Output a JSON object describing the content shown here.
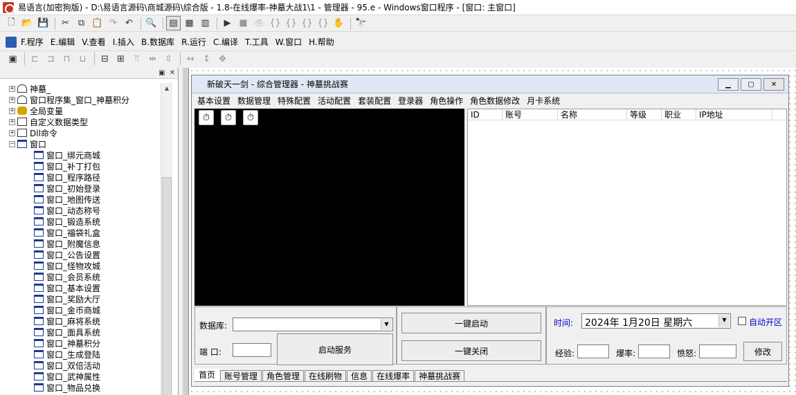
{
  "window": {
    "title": "易语言(加密狗版) - D:\\易语言源码\\商城源码\\综合版 - 1.8-在线爆率-神墓大战1\\1 - 管理器 - 95.e - Windows窗口程序 - [窗口: 主窗口]"
  },
  "toolbar1": {
    "icons": [
      "new-file-icon",
      "open-folder-icon",
      "save-icon",
      "cut-icon",
      "copy-icon",
      "paste-icon",
      "redo-icon",
      "undo-icon",
      "find-icon",
      "layout-1-icon",
      "layout-2-icon",
      "layout-3-icon",
      "run-icon",
      "stop-icon",
      "step-1-icon",
      "step-2-icon",
      "step-3-icon",
      "step-4-icon",
      "step-5-icon",
      "hand-icon",
      "binoculars-icon"
    ]
  },
  "menubar": {
    "items": [
      "F.程序",
      "E.编辑",
      "V.查看",
      "I.插入",
      "B.数据库",
      "R.运行",
      "C.编译",
      "T.工具",
      "W.窗口",
      "H.帮助"
    ]
  },
  "tree": {
    "roots": [
      {
        "label": "神墓_",
        "icon": "library-icon",
        "expander": "+"
      },
      {
        "label": "窗口程序集_窗口_神墓积分",
        "icon": "library-icon",
        "expander": "+"
      },
      {
        "label": "全局变量",
        "icon": "database-icon",
        "expander": "+"
      },
      {
        "label": "自定义数据类型",
        "icon": "type-icon",
        "expander": "+"
      },
      {
        "label": "Dll命令",
        "icon": "dll-icon",
        "expander": "+"
      },
      {
        "label": "窗口",
        "icon": "window-icon",
        "expander": "−"
      }
    ],
    "children": [
      "窗口_绑元商城",
      "窗口_补丁打包",
      "窗口_程序路径",
      "窗口_初始登录",
      "窗口_地图传送",
      "窗口_动态称号",
      "窗口_锻造系统",
      "窗口_福袋礼盒",
      "窗口_附魔信息",
      "窗口_公告设置",
      "窗口_怪物攻城",
      "窗口_会员系统",
      "窗口_基本设置",
      "窗口_奖励大厅",
      "窗口_金币商城",
      "窗口_麻将系统",
      "窗口_面具系统",
      "窗口_神墓积分",
      "窗口_生成登陆",
      "窗口_双倍活动",
      "窗口_武神属性",
      "窗口_物品兑换"
    ]
  },
  "form": {
    "title": "新破天一剑 - 综合管理器 - 神墓挑战赛",
    "menu": [
      "基本设置",
      "数据管理",
      "特殊配置",
      "活动配置",
      "套装配置",
      "登录器",
      "角色操作",
      "角色数据修改",
      "月卡系统"
    ],
    "grid_columns": [
      "ID",
      "账号",
      "名称",
      "等级",
      "职业",
      "IP地址"
    ],
    "db_label": "数据库:",
    "port_label": "端  口:",
    "start_service": "启动服务",
    "one_click_start": "一键启动",
    "one_click_close": "一键关闭",
    "time_label": "时间:",
    "date_value": "2024年  1月20日  星期六",
    "auto_open_label": "自动开区",
    "exp_label": "经验:",
    "drop_label": "爆率:",
    "anger_label": "愤怒:",
    "modify_button": "修改",
    "tabs": [
      "首页",
      "账号管理",
      "角色管理",
      "在线刷物",
      "信息",
      "在线爆率",
      "神墓挑战赛"
    ]
  },
  "colors": {
    "accent_blue": "#1c3a8a",
    "time_label": "#0000cc",
    "auto_open": "#0000cc"
  }
}
